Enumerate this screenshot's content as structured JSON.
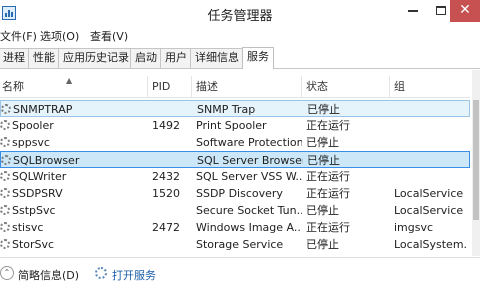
{
  "window": {
    "title": "任务管理器",
    "accent": "#3a8ee6",
    "close_color": "#c75050"
  },
  "menu": [
    {
      "label": "文件(F)"
    },
    {
      "label": "选项(O)"
    },
    {
      "label": "查看(V)"
    }
  ],
  "tabs": [
    {
      "label": "进程",
      "active": false
    },
    {
      "label": "性能",
      "active": false
    },
    {
      "label": "应用历史记录",
      "active": false
    },
    {
      "label": "启动",
      "active": false
    },
    {
      "label": "用户",
      "active": false
    },
    {
      "label": "详细信息",
      "active": false
    },
    {
      "label": "服务",
      "active": true
    }
  ],
  "table": {
    "columns": [
      "名称",
      "PID",
      "描述",
      "状态",
      "组"
    ],
    "rows": [
      {
        "name": "SNMPTRAP",
        "pid": "",
        "desc": "SNMP Trap",
        "status": "已停止",
        "group": "",
        "icon": "service-gear-icon",
        "state": "selected-dim"
      },
      {
        "name": "Spooler",
        "pid": "1492",
        "desc": "Print Spooler",
        "status": "正在运行",
        "group": "",
        "icon": "service-gear-icon",
        "state": ""
      },
      {
        "name": "sppsvc",
        "pid": "",
        "desc": "Software Protection",
        "status": "已停止",
        "group": "",
        "icon": "service-gear-icon",
        "state": ""
      },
      {
        "name": "SQLBrowser",
        "pid": "",
        "desc": "SQL Server Browser",
        "status": "已停止",
        "group": "",
        "icon": "service-gear-icon",
        "state": "selected"
      },
      {
        "name": "SQLWriter",
        "pid": "2432",
        "desc": "SQL Server VSS W...",
        "status": "正在运行",
        "group": "",
        "icon": "service-gear-icon",
        "state": ""
      },
      {
        "name": "SSDPSRV",
        "pid": "1520",
        "desc": "SSDP Discovery",
        "status": "正在运行",
        "group": "LocalService",
        "icon": "service-gear-icon",
        "state": ""
      },
      {
        "name": "SstpSvc",
        "pid": "",
        "desc": "Secure Socket Tun...",
        "status": "已停止",
        "group": "LocalService",
        "icon": "service-gear-icon",
        "state": ""
      },
      {
        "name": "stisvc",
        "pid": "2472",
        "desc": "Windows Image A...",
        "status": "正在运行",
        "group": "imgsvc",
        "icon": "service-gear-icon",
        "state": ""
      },
      {
        "name": "StorSvc",
        "pid": "",
        "desc": "Storage Service",
        "status": "已停止",
        "group": "LocalSystem...",
        "icon": "service-gear-icon",
        "state": ""
      }
    ]
  },
  "footer": {
    "fewer_details": "简略信息(D)",
    "open_services": "打开服务"
  }
}
